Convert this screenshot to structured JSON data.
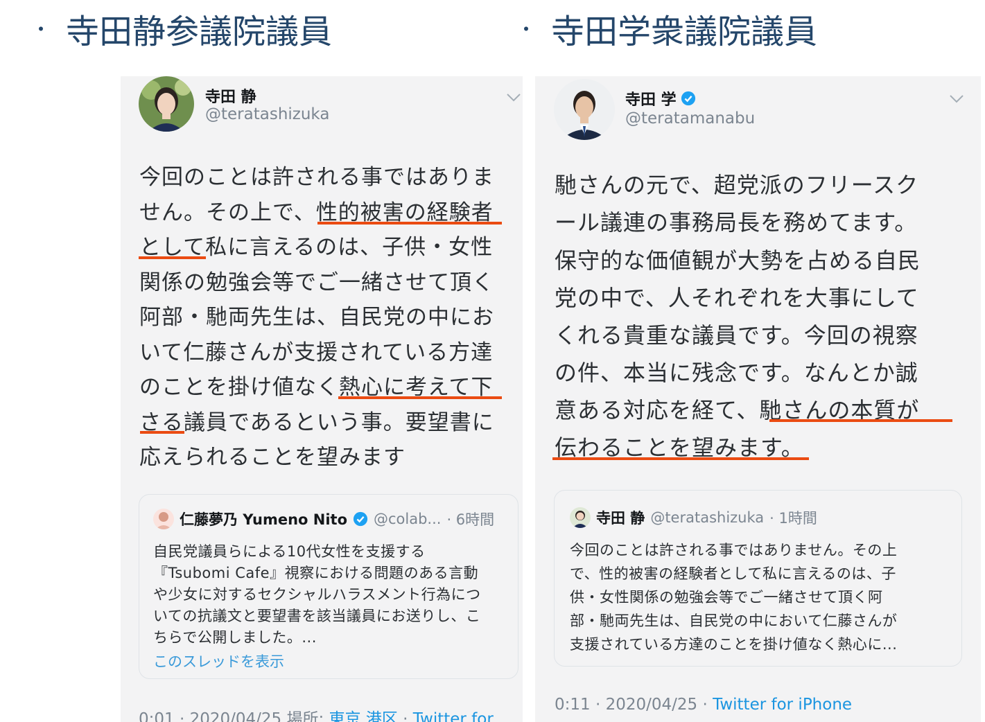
{
  "headings": {
    "bullet": "・",
    "left": "寺田静参議院議員",
    "right": "寺田学衆議院議員"
  },
  "left_tweet": {
    "name": "寺田 静",
    "handle": "@teratashizuka",
    "body_lines": [
      "今回のことは許される事ではありま",
      "せん。その上で、性的被害の経験者",
      "として私に言えるのは、子供・女性",
      "関係の勉強会等でご一緒させて頂く",
      "阿部・馳両先生は、自民党の中にお",
      "いて仁藤さんが支援されている方達",
      "のことを掛け値なく熱心に考えて下",
      "さる議員であるという事。要望書に",
      "応えられることを望みます"
    ],
    "quote": {
      "name": "仁藤夢乃 Yumeno Nito",
      "handle": "@colab...",
      "time": "· 6時間",
      "lines": [
        "自民党議員らによる10代女性を支援する",
        "『Tsubomi Cafe』視察における問題のある言動",
        "や少女に対するセクシャルハラスメント行為につ",
        "いての抗議文と要望書を該当議員にお送りし、こ",
        "ちらで公開しました。..."
      ],
      "link": "このスレッドを表示"
    },
    "footer": {
      "time": "0:01 · 2020/04/25 場所: ",
      "place": "東京 港区",
      "sep": " · ",
      "client": "Twitter for"
    }
  },
  "right_tweet": {
    "name": "寺田 学",
    "handle": "@teratamanabu",
    "body_lines": [
      "馳さんの元で、超党派のフリースク",
      "ール議連の事務局長を務めてます。",
      "保守的な価値観が大勢を占める自民",
      "党の中で、人それぞれを大事にして",
      "くれる貴重な議員です。今回の視察",
      "の件、本当に残念です。なんとか誠",
      "意ある対応を経て、馳さんの本質が",
      "伝わることを望みます。"
    ],
    "quote": {
      "name": "寺田 静",
      "handle": "@teratashizuka",
      "time": "· 1時間",
      "lines": [
        "今回のことは許される事ではありません。その上",
        "で、性的被害の経験者として私に言えるのは、子",
        "供・女性関係の勉強会等でご一緒させて頂く阿",
        "部・馳両先生は、自民党の中において仁藤さんが",
        "支援されている方達のことを掛け値なく熱心に..."
      ]
    },
    "footer": {
      "time": "0:11 · 2020/04/25 · ",
      "client": "Twitter for iPhone"
    }
  },
  "colors": {
    "heading": "#24466a",
    "underline": "#ea4b12",
    "card_bg": "#f3f3f4",
    "link": "#1b95e0",
    "verified": "#1da1f2"
  },
  "icons": [
    "chevron-down-icon",
    "verified-badge-icon",
    "avatar"
  ]
}
